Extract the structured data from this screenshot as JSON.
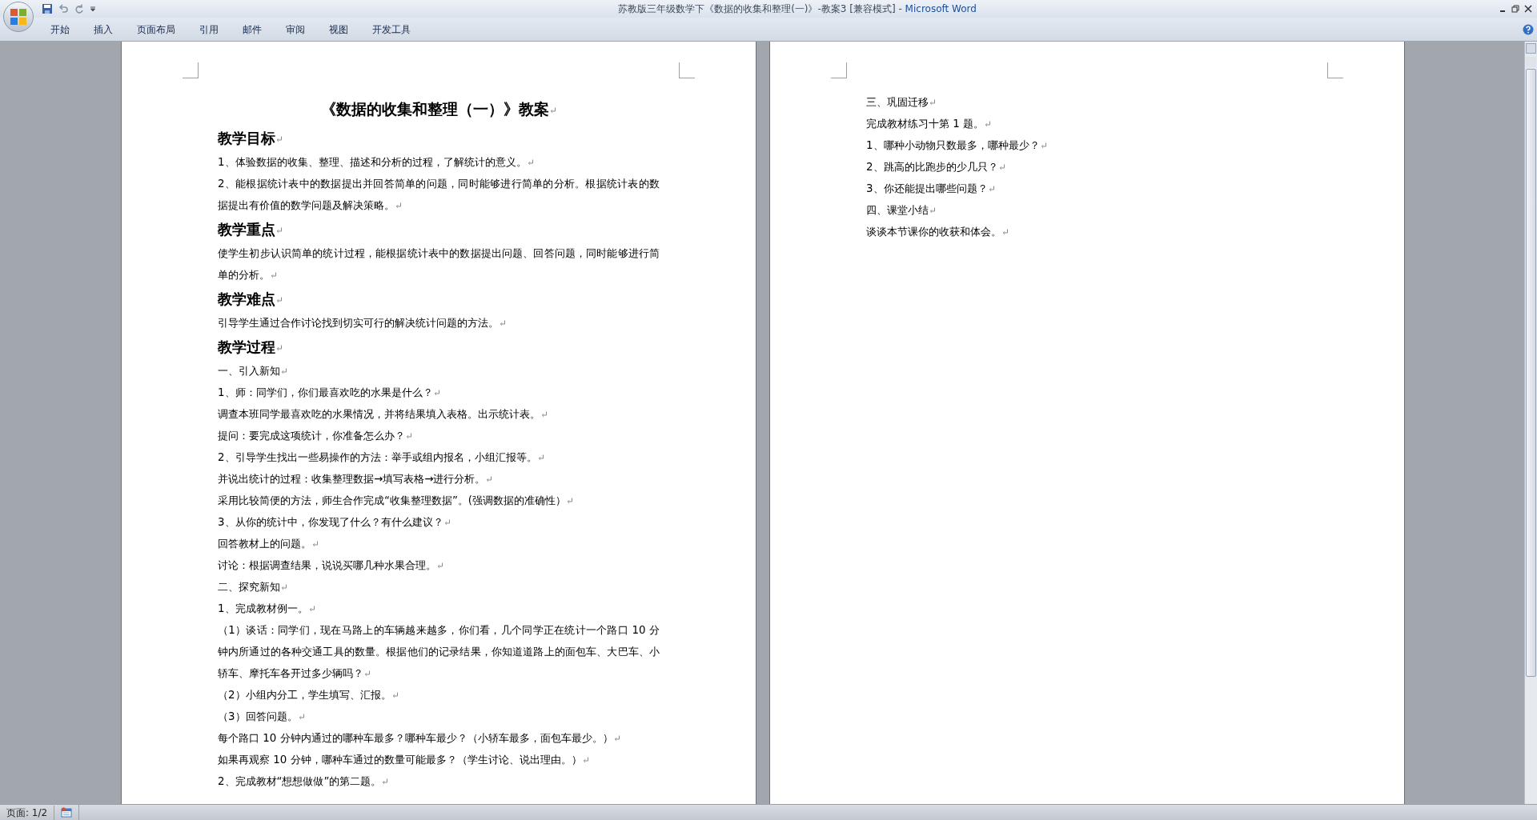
{
  "window": {
    "title": "苏教版三年级数学下《数据的收集和整理(一)》-教案3 [兼容模式] - ",
    "app_name": "Microsoft Word"
  },
  "ribbon_tabs": [
    "开始",
    "插入",
    "页面布局",
    "引用",
    "邮件",
    "审阅",
    "视图",
    "开发工具"
  ],
  "pages": [
    {
      "paragraphs": [
        {
          "kind": "title",
          "text": "《数据的收集和整理（一）》教案"
        },
        {
          "kind": "heading",
          "text": "教学目标"
        },
        {
          "kind": "body",
          "text": "1、体验数据的收集、整理、描述和分析的过程，了解统计的意义。"
        },
        {
          "kind": "body",
          "text": "2、能根据统计表中的数据提出并回答简单的问题，同时能够进行简单的分析。根据统计表的数据提出有价值的数学问题及解决策略。"
        },
        {
          "kind": "heading",
          "text": "教学重点"
        },
        {
          "kind": "body",
          "text": "使学生初步认识简单的统计过程，能根据统计表中的数据提出问题、回答问题，同时能够进行简单的分析。"
        },
        {
          "kind": "heading",
          "text": "教学难点"
        },
        {
          "kind": "body",
          "text": "引导学生通过合作讨论找到切实可行的解决统计问题的方法。"
        },
        {
          "kind": "heading",
          "text": "教学过程"
        },
        {
          "kind": "body",
          "text": "一、引入新知"
        },
        {
          "kind": "body",
          "text": "1、师：同学们，你们最喜欢吃的水果是什么？"
        },
        {
          "kind": "body",
          "text": "调查本班同学最喜欢吃的水果情况，并将结果填入表格。出示统计表。"
        },
        {
          "kind": "body",
          "text": "提问：要完成这项统计，你准备怎么办？"
        },
        {
          "kind": "body",
          "text": "2、引导学生找出一些易操作的方法：举手或组内报名，小组汇报等。"
        },
        {
          "kind": "body",
          "text": "并说出统计的过程：收集整理数据→填写表格→进行分析。"
        },
        {
          "kind": "body",
          "text": "采用比较简便的方法，师生合作完成“收集整理数据”。(强调数据的准确性）"
        },
        {
          "kind": "body",
          "text": "3、从你的统计中，你发现了什么？有什么建议？"
        },
        {
          "kind": "body",
          "text": "回答教材上的问题。"
        },
        {
          "kind": "body",
          "text": "讨论：根据调查结果，说说买哪几种水果合理。"
        },
        {
          "kind": "body",
          "text": "二、探究新知"
        },
        {
          "kind": "body",
          "text": "1、完成教材例一。"
        },
        {
          "kind": "body",
          "text": "（1）谈话：同学们，现在马路上的车辆越来越多，你们看，几个同学正在统计一个路口 10 分钟内所通过的各种交通工具的数量。根据他们的记录结果，你知道道路上的面包车、大巴车、小轿车、摩托车各开过多少辆吗？"
        },
        {
          "kind": "body",
          "text": "（2）小组内分工，学生填写、汇报。"
        },
        {
          "kind": "body",
          "text": "（3）回答问题。"
        },
        {
          "kind": "body",
          "text": "每个路口 10 分钟内通过的哪种车最多？哪种车最少？（小轿车最多，面包车最少。）"
        },
        {
          "kind": "body",
          "text": "如果再观察 10 分钟，哪种车通过的数量可能最多？（学生讨论、说出理由。）"
        },
        {
          "kind": "body",
          "text": "2、完成教材“想想做做”的第二题。"
        }
      ]
    },
    {
      "paragraphs": [
        {
          "kind": "body",
          "text": "三、巩固迁移"
        },
        {
          "kind": "body",
          "text": "完成教材练习十第 1 题。"
        },
        {
          "kind": "body",
          "text": "1、哪种小动物只数最多，哪种最少？"
        },
        {
          "kind": "body",
          "text": "2、跳高的比跑步的少几只？"
        },
        {
          "kind": "body",
          "text": "3、你还能提出哪些问题？"
        },
        {
          "kind": "body",
          "text": "四、课堂小结"
        },
        {
          "kind": "body",
          "text": "谈谈本节课你的收获和体会。"
        }
      ]
    }
  ],
  "status_bar": {
    "page": "页面: 1/2"
  }
}
